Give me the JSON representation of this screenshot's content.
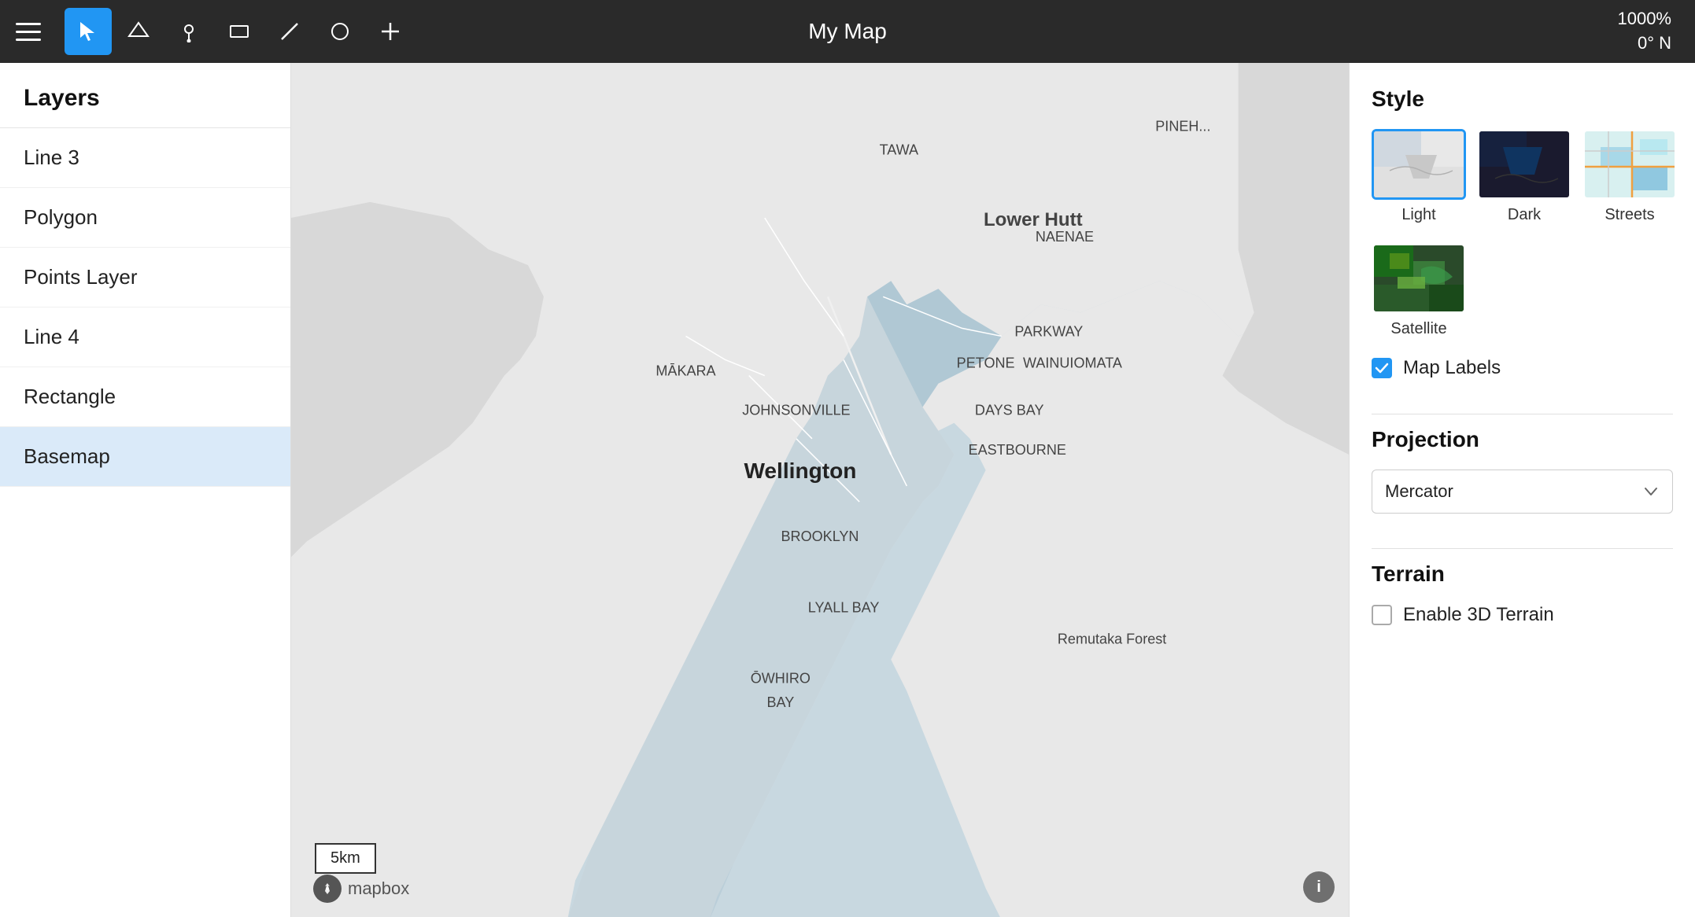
{
  "toolbar": {
    "title": "My Map",
    "zoom": "1000%",
    "rotation": "0° N",
    "tools": [
      {
        "id": "cursor",
        "label": "Cursor",
        "active": true,
        "icon": "➤"
      },
      {
        "id": "polygon",
        "label": "Polygon",
        "active": false,
        "icon": "△"
      },
      {
        "id": "marker",
        "label": "Marker",
        "active": false,
        "icon": "⊙"
      },
      {
        "id": "rectangle",
        "label": "Rectangle",
        "active": false,
        "icon": "□"
      },
      {
        "id": "line",
        "label": "Line",
        "active": false,
        "icon": "╱"
      },
      {
        "id": "circle",
        "label": "Circle",
        "active": false,
        "icon": "○"
      },
      {
        "id": "add",
        "label": "Add",
        "active": false,
        "icon": "+"
      }
    ]
  },
  "sidebar": {
    "header": "Layers",
    "items": [
      {
        "id": "line3",
        "label": "Line 3",
        "selected": false
      },
      {
        "id": "polygon",
        "label": "Polygon",
        "selected": false
      },
      {
        "id": "points-layer",
        "label": "Points Layer",
        "selected": false
      },
      {
        "id": "line4",
        "label": "Line 4",
        "selected": false
      },
      {
        "id": "rectangle",
        "label": "Rectangle",
        "selected": false
      },
      {
        "id": "basemap",
        "label": "Basemap",
        "selected": true
      }
    ]
  },
  "map": {
    "scale_label": "5km",
    "logo": "mapbox",
    "info_icon": "i"
  },
  "right_panel": {
    "style_section": "Style",
    "styles": [
      {
        "id": "light",
        "label": "Light",
        "selected": true
      },
      {
        "id": "dark",
        "label": "Dark",
        "selected": false
      },
      {
        "id": "streets",
        "label": "Streets",
        "selected": false
      }
    ],
    "style_row2": [
      {
        "id": "satellite",
        "label": "Satellite",
        "selected": false
      }
    ],
    "map_labels_label": "Map Labels",
    "map_labels_checked": true,
    "projection_section": "Projection",
    "projection_value": "Mercator",
    "terrain_section": "Terrain",
    "terrain_checkbox_label": "Enable 3D Terrain",
    "terrain_checked": false
  }
}
